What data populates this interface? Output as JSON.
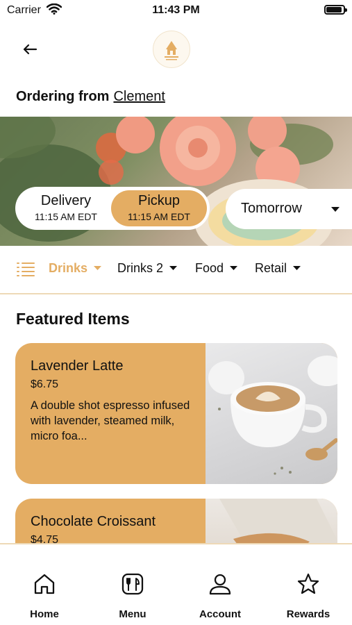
{
  "status_bar": {
    "carrier": "Carrier",
    "time": "11:43 PM"
  },
  "header": {
    "ordering_label": "Ordering from",
    "location": "Clement"
  },
  "fulfillment": {
    "delivery_label": "Delivery",
    "delivery_time": "11:15 AM EDT",
    "pickup_label": "Pickup",
    "pickup_time": "11:15 AM EDT",
    "selected": "Pickup",
    "date": "Tomorrow"
  },
  "categories": [
    {
      "label": "Drinks",
      "active": true
    },
    {
      "label": "Drinks 2",
      "active": false
    },
    {
      "label": "Food",
      "active": false
    },
    {
      "label": "Retail",
      "active": false
    }
  ],
  "featured": {
    "title": "Featured Items",
    "items": [
      {
        "name": "Lavender Latte",
        "price": "$6.75",
        "description": "A double shot espresso infused with lavender, steamed milk, micro foa..."
      },
      {
        "name": "Chocolate Croissant",
        "price": "$4.75",
        "description": ""
      }
    ]
  },
  "tabs": [
    {
      "label": "Home",
      "icon": "home-icon"
    },
    {
      "label": "Menu",
      "icon": "menu-icon"
    },
    {
      "label": "Account",
      "icon": "account-icon"
    },
    {
      "label": "Rewards",
      "icon": "rewards-icon"
    }
  ],
  "colors": {
    "accent": "#e4ad63",
    "divider": "#eed9b6",
    "text": "#111111"
  }
}
